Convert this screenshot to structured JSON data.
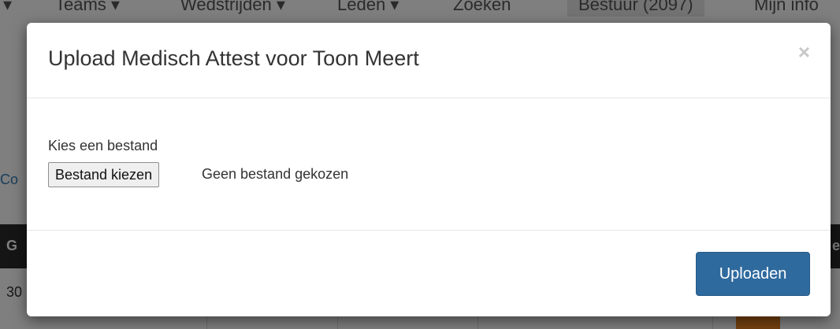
{
  "background": {
    "nav": [
      "Teams ▾",
      "Wedstrijden ▾",
      "Leden ▾",
      "Zoeken",
      "Bestuur (2097)",
      "Mijn info"
    ],
    "link_fragment": "Co",
    "header_left": "G",
    "header_right": "e",
    "row_value": "30"
  },
  "modal": {
    "title": "Upload Medisch Attest voor Toon Meert",
    "close_label": "×",
    "field_label": "Kies een bestand",
    "file_button_label": "Bestand kiezen",
    "file_status": "Geen bestand gekozen",
    "submit_label": "Uploaden"
  },
  "colors": {
    "primary": "#2f6a9e",
    "overlay": "rgba(0,0,0,0.5)"
  }
}
